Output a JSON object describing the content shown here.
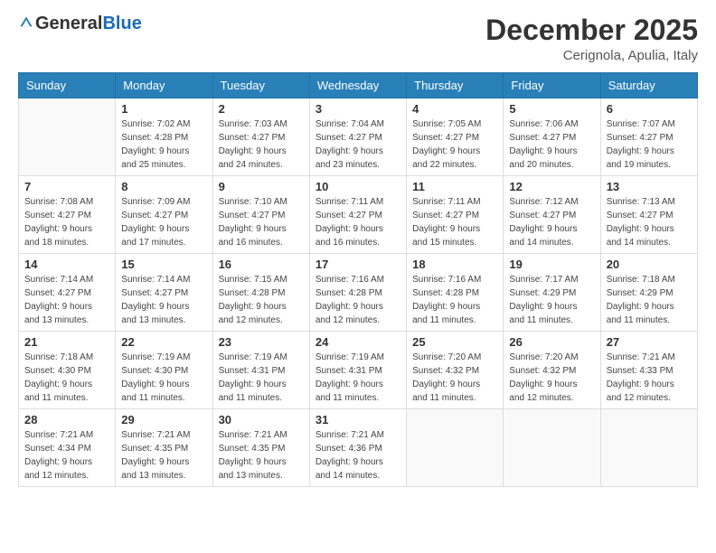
{
  "header": {
    "logo_general": "General",
    "logo_blue": "Blue",
    "month_title": "December 2025",
    "location": "Cerignola, Apulia, Italy"
  },
  "weekdays": [
    "Sunday",
    "Monday",
    "Tuesday",
    "Wednesday",
    "Thursday",
    "Friday",
    "Saturday"
  ],
  "weeks": [
    [
      {
        "day": "",
        "sunrise": "",
        "sunset": "",
        "daylight": ""
      },
      {
        "day": "1",
        "sunrise": "Sunrise: 7:02 AM",
        "sunset": "Sunset: 4:28 PM",
        "daylight": "Daylight: 9 hours and 25 minutes."
      },
      {
        "day": "2",
        "sunrise": "Sunrise: 7:03 AM",
        "sunset": "Sunset: 4:27 PM",
        "daylight": "Daylight: 9 hours and 24 minutes."
      },
      {
        "day": "3",
        "sunrise": "Sunrise: 7:04 AM",
        "sunset": "Sunset: 4:27 PM",
        "daylight": "Daylight: 9 hours and 23 minutes."
      },
      {
        "day": "4",
        "sunrise": "Sunrise: 7:05 AM",
        "sunset": "Sunset: 4:27 PM",
        "daylight": "Daylight: 9 hours and 22 minutes."
      },
      {
        "day": "5",
        "sunrise": "Sunrise: 7:06 AM",
        "sunset": "Sunset: 4:27 PM",
        "daylight": "Daylight: 9 hours and 20 minutes."
      },
      {
        "day": "6",
        "sunrise": "Sunrise: 7:07 AM",
        "sunset": "Sunset: 4:27 PM",
        "daylight": "Daylight: 9 hours and 19 minutes."
      }
    ],
    [
      {
        "day": "7",
        "sunrise": "Sunrise: 7:08 AM",
        "sunset": "Sunset: 4:27 PM",
        "daylight": "Daylight: 9 hours and 18 minutes."
      },
      {
        "day": "8",
        "sunrise": "Sunrise: 7:09 AM",
        "sunset": "Sunset: 4:27 PM",
        "daylight": "Daylight: 9 hours and 17 minutes."
      },
      {
        "day": "9",
        "sunrise": "Sunrise: 7:10 AM",
        "sunset": "Sunset: 4:27 PM",
        "daylight": "Daylight: 9 hours and 16 minutes."
      },
      {
        "day": "10",
        "sunrise": "Sunrise: 7:11 AM",
        "sunset": "Sunset: 4:27 PM",
        "daylight": "Daylight: 9 hours and 16 minutes."
      },
      {
        "day": "11",
        "sunrise": "Sunrise: 7:11 AM",
        "sunset": "Sunset: 4:27 PM",
        "daylight": "Daylight: 9 hours and 15 minutes."
      },
      {
        "day": "12",
        "sunrise": "Sunrise: 7:12 AM",
        "sunset": "Sunset: 4:27 PM",
        "daylight": "Daylight: 9 hours and 14 minutes."
      },
      {
        "day": "13",
        "sunrise": "Sunrise: 7:13 AM",
        "sunset": "Sunset: 4:27 PM",
        "daylight": "Daylight: 9 hours and 14 minutes."
      }
    ],
    [
      {
        "day": "14",
        "sunrise": "Sunrise: 7:14 AM",
        "sunset": "Sunset: 4:27 PM",
        "daylight": "Daylight: 9 hours and 13 minutes."
      },
      {
        "day": "15",
        "sunrise": "Sunrise: 7:14 AM",
        "sunset": "Sunset: 4:27 PM",
        "daylight": "Daylight: 9 hours and 13 minutes."
      },
      {
        "day": "16",
        "sunrise": "Sunrise: 7:15 AM",
        "sunset": "Sunset: 4:28 PM",
        "daylight": "Daylight: 9 hours and 12 minutes."
      },
      {
        "day": "17",
        "sunrise": "Sunrise: 7:16 AM",
        "sunset": "Sunset: 4:28 PM",
        "daylight": "Daylight: 9 hours and 12 minutes."
      },
      {
        "day": "18",
        "sunrise": "Sunrise: 7:16 AM",
        "sunset": "Sunset: 4:28 PM",
        "daylight": "Daylight: 9 hours and 11 minutes."
      },
      {
        "day": "19",
        "sunrise": "Sunrise: 7:17 AM",
        "sunset": "Sunset: 4:29 PM",
        "daylight": "Daylight: 9 hours and 11 minutes."
      },
      {
        "day": "20",
        "sunrise": "Sunrise: 7:18 AM",
        "sunset": "Sunset: 4:29 PM",
        "daylight": "Daylight: 9 hours and 11 minutes."
      }
    ],
    [
      {
        "day": "21",
        "sunrise": "Sunrise: 7:18 AM",
        "sunset": "Sunset: 4:30 PM",
        "daylight": "Daylight: 9 hours and 11 minutes."
      },
      {
        "day": "22",
        "sunrise": "Sunrise: 7:19 AM",
        "sunset": "Sunset: 4:30 PM",
        "daylight": "Daylight: 9 hours and 11 minutes."
      },
      {
        "day": "23",
        "sunrise": "Sunrise: 7:19 AM",
        "sunset": "Sunset: 4:31 PM",
        "daylight": "Daylight: 9 hours and 11 minutes."
      },
      {
        "day": "24",
        "sunrise": "Sunrise: 7:19 AM",
        "sunset": "Sunset: 4:31 PM",
        "daylight": "Daylight: 9 hours and 11 minutes."
      },
      {
        "day": "25",
        "sunrise": "Sunrise: 7:20 AM",
        "sunset": "Sunset: 4:32 PM",
        "daylight": "Daylight: 9 hours and 11 minutes."
      },
      {
        "day": "26",
        "sunrise": "Sunrise: 7:20 AM",
        "sunset": "Sunset: 4:32 PM",
        "daylight": "Daylight: 9 hours and 12 minutes."
      },
      {
        "day": "27",
        "sunrise": "Sunrise: 7:21 AM",
        "sunset": "Sunset: 4:33 PM",
        "daylight": "Daylight: 9 hours and 12 minutes."
      }
    ],
    [
      {
        "day": "28",
        "sunrise": "Sunrise: 7:21 AM",
        "sunset": "Sunset: 4:34 PM",
        "daylight": "Daylight: 9 hours and 12 minutes."
      },
      {
        "day": "29",
        "sunrise": "Sunrise: 7:21 AM",
        "sunset": "Sunset: 4:35 PM",
        "daylight": "Daylight: 9 hours and 13 minutes."
      },
      {
        "day": "30",
        "sunrise": "Sunrise: 7:21 AM",
        "sunset": "Sunset: 4:35 PM",
        "daylight": "Daylight: 9 hours and 13 minutes."
      },
      {
        "day": "31",
        "sunrise": "Sunrise: 7:21 AM",
        "sunset": "Sunset: 4:36 PM",
        "daylight": "Daylight: 9 hours and 14 minutes."
      },
      {
        "day": "",
        "sunrise": "",
        "sunset": "",
        "daylight": ""
      },
      {
        "day": "",
        "sunrise": "",
        "sunset": "",
        "daylight": ""
      },
      {
        "day": "",
        "sunrise": "",
        "sunset": "",
        "daylight": ""
      }
    ]
  ]
}
